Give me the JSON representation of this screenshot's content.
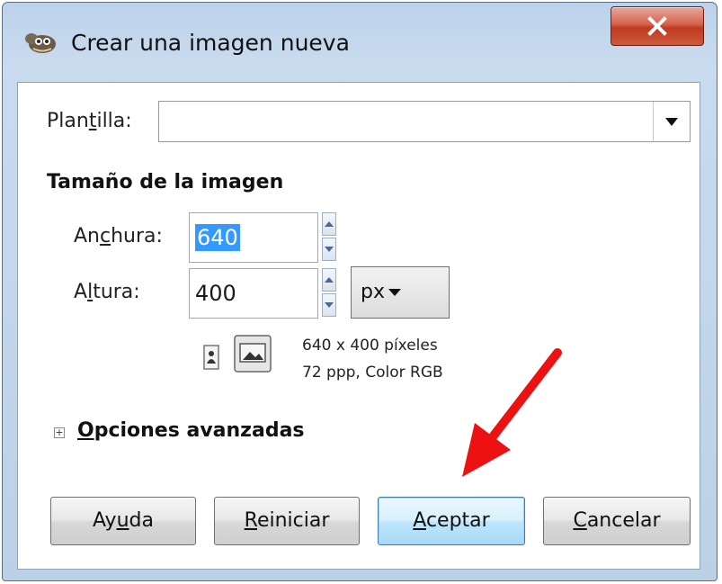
{
  "window": {
    "title": "Crear una imagen nueva",
    "close_label": "X"
  },
  "template": {
    "label_pre": "Plan",
    "label_u": "t",
    "label_post": "illa:",
    "value": ""
  },
  "image_size": {
    "heading": "Tamaño de la imagen",
    "width": {
      "label_pre": "An",
      "label_u": "c",
      "label_post": "hura:",
      "value": "640"
    },
    "height": {
      "label_pre": "A",
      "label_u": "l",
      "label_post": "tura:",
      "value": "400"
    },
    "unit": "px",
    "info_line1": "640 x 400 píxeles",
    "info_line2": "72 ppp, Color RGB"
  },
  "advanced": {
    "expander": "+",
    "label_u": "O",
    "label_post": "pciones avanzadas"
  },
  "buttons": {
    "help": {
      "pre": "Ay",
      "u": "u",
      "post": "da"
    },
    "reset": {
      "pre": "",
      "u": "R",
      "post": "einiciar"
    },
    "ok": {
      "pre": "",
      "u": "A",
      "post": "ceptar"
    },
    "cancel": {
      "pre": "",
      "u": "C",
      "post": "ancelar"
    }
  },
  "annotation": {
    "arrow_color": "#ee1111"
  },
  "colors": {
    "selection": "#3399ff",
    "close_button": "#c0391f",
    "frame": "#bcd2ea"
  }
}
